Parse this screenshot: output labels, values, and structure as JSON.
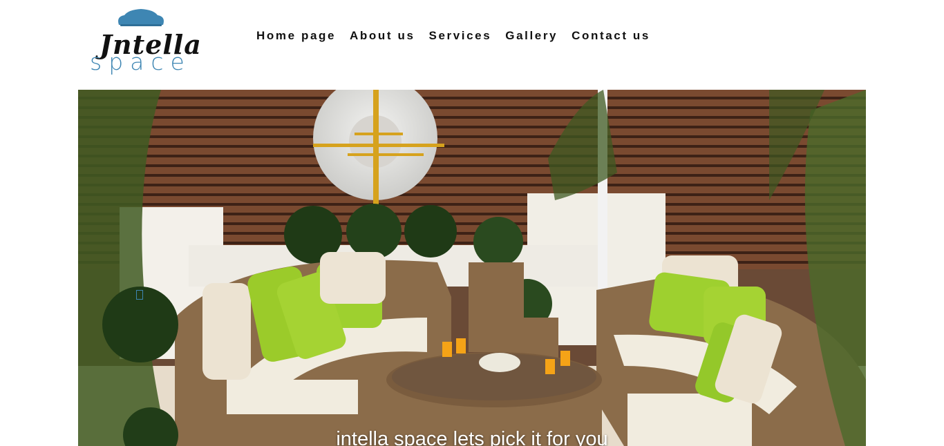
{
  "brand": {
    "word1": "Jntella",
    "word2": "space",
    "accent_color": "#3e86b3",
    "icon": "sofa-icon"
  },
  "nav": {
    "items": [
      {
        "label": "Home page"
      },
      {
        "label": "About us"
      },
      {
        "label": "Services"
      },
      {
        "label": "Gallery"
      },
      {
        "label": "Contact us"
      }
    ]
  },
  "hero": {
    "caption": "intella space lets pick it for you",
    "image": "outdoor-patio-wicker-sofa-photo"
  }
}
